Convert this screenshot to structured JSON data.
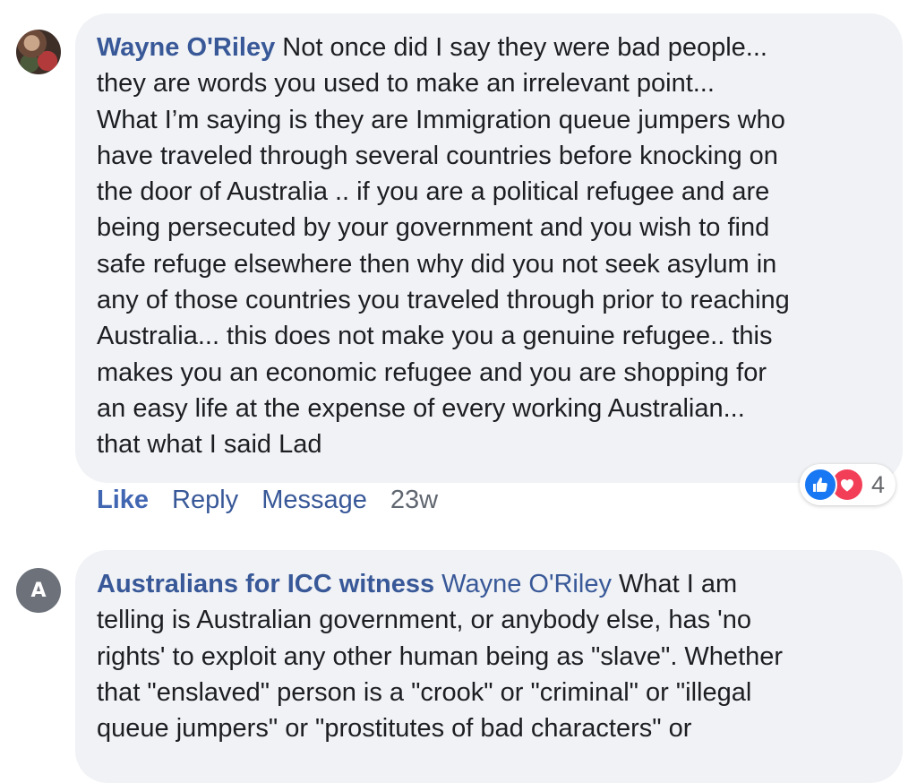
{
  "comments": [
    {
      "avatar": {
        "type": "photo"
      },
      "author": "Wayne O'Riley",
      "body": "Not once did I say they were bad people...\nthey are words you used to make an irrelevant point...\nWhat I’m saying is they are Immigration queue jumpers who\nhave traveled through several countries before knocking on\nthe door of Australia .. if you are a political refugee and are\nbeing persecuted by your government and you wish to find\nsafe refuge elsewhere then why did you not seek asylum in\nany of those countries you traveled through prior to reaching\nAustralia... this does not make you a genuine refugee.. this\nmakes you an economic refugee and you are shopping for\nan easy life at the expense of every working Australian...\nthat what I said Lad",
      "actions": {
        "like": "Like",
        "reply": "Reply",
        "message": "Message",
        "time": "23w"
      },
      "reactions": {
        "icons": [
          "like-icon",
          "love-icon"
        ],
        "count": "4"
      }
    },
    {
      "avatar": {
        "type": "letter",
        "letter": "A"
      },
      "author": "Australians for ICC witness",
      "mention": "Wayne O'Riley",
      "body": "What I am\ntelling is Australian government, or anybody else, has 'no\nrights' to exploit any other human being as \"slave\". Whether\nthat \"enslaved\" person is a \"crook\" or \"criminal\" or \"illegal\nqueue jumpers\" or \"prostitutes of bad characters\" or"
    }
  ],
  "colors": {
    "bubble": "#f0f2f5",
    "author": "#385898",
    "like_blue": "#1877f2",
    "love_red": "#f33e58"
  }
}
